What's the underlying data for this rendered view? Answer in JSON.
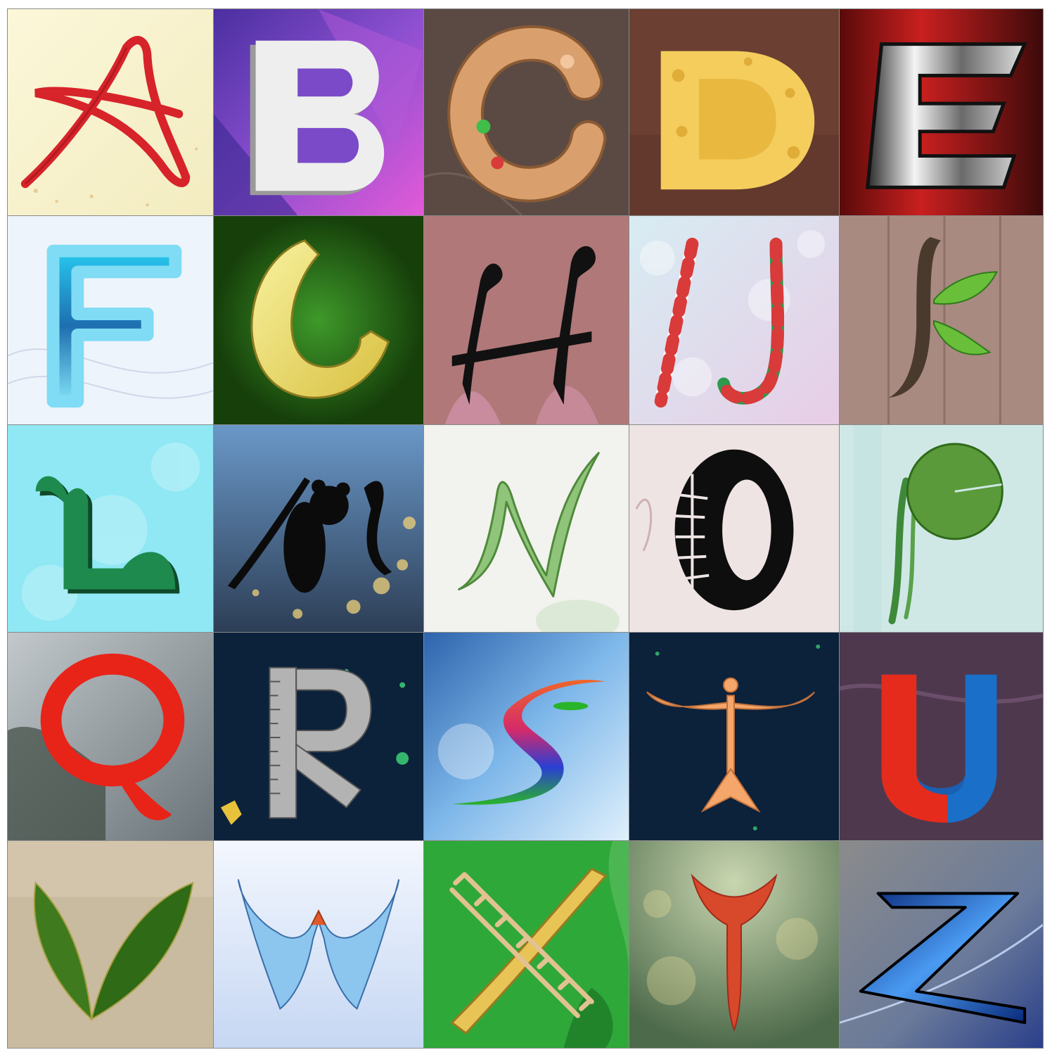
{
  "tiles": [
    {
      "letter": "A",
      "icon": "red-ribbon-a-icon",
      "bg": [
        "#fbf7d9",
        "#f3ecc0"
      ],
      "color": "#d7232a"
    },
    {
      "letter": "B",
      "icon": "white-3d-block-b-icon",
      "bg": [
        "#5b3fb8",
        "#d652d6"
      ],
      "color": "#eeeeee"
    },
    {
      "letter": "C",
      "icon": "gingerbread-cookie-c-icon",
      "bg": [
        "#5e4e47",
        "#4b3d37"
      ],
      "color": "#d9a06e"
    },
    {
      "letter": "D",
      "icon": "cheese-d-icon",
      "bg": [
        "#7a4a3b",
        "#5c3427"
      ],
      "color": "#f5cd5c"
    },
    {
      "letter": "E",
      "icon": "chrome-metal-e-icon",
      "bg": [
        "#b81d1d",
        "#3d0a0a"
      ],
      "color": "#c8c8c8"
    },
    {
      "letter": "F",
      "icon": "blue-cloud-f-icon",
      "bg": [
        "#eef4fb",
        "#e4ecf6"
      ],
      "color": "#2fb8e6"
    },
    {
      "letter": "G",
      "icon": "yellow-banana-g-icon",
      "bg": [
        "#2f7d1a",
        "#1a4d0c"
      ],
      "color": "#f2e56a"
    },
    {
      "letter": "H",
      "icon": "black-music-note-h-icon",
      "bg": [
        "#b07878",
        "#8f5a5a"
      ],
      "color": "#111111"
    },
    {
      "letter": "IJ",
      "icon": "candy-cane-ij-icon",
      "bg": [
        "#d8e8f0",
        "#e8cde6"
      ],
      "color": "#d93a3a"
    },
    {
      "letter": "K",
      "icon": "wood-leaf-k-icon",
      "bg": [
        "#a98a80",
        "#8d7068"
      ],
      "color": "#4a3a2e"
    },
    {
      "letter": "L",
      "icon": "green-dinosaur-l-icon",
      "bg": [
        "#7fe4f2",
        "#a9eef6"
      ],
      "color": "#1e8a4e"
    },
    {
      "letter": "M",
      "icon": "black-mouse-m-icon",
      "bg": [
        "#6a98c8",
        "#33465e"
      ],
      "color": "#0b0b0b"
    },
    {
      "letter": "N",
      "icon": "green-leaf-n-icon",
      "bg": [
        "#f2f2ef",
        "#e8ebe4"
      ],
      "color": "#5c9c48"
    },
    {
      "letter": "O",
      "icon": "tire-o-icon",
      "bg": [
        "#efe4e4",
        "#e6d6d8"
      ],
      "color": "#0e0e0e"
    },
    {
      "letter": "P",
      "icon": "lily-pad-p-icon",
      "bg": [
        "#cfe8e6",
        "#b9dedb"
      ],
      "color": "#4f8a3a"
    },
    {
      "letter": "Q",
      "icon": "red-fuzzy-q-icon",
      "bg": [
        "#9aa4ad",
        "#3e4a42"
      ],
      "color": "#e82419"
    },
    {
      "letter": "R",
      "icon": "ruler-protractor-r-icon",
      "bg": [
        "#0c213a",
        "#0a1b30"
      ],
      "color": "#b3b3b3"
    },
    {
      "letter": "S",
      "icon": "rainbow-wave-s-icon",
      "bg": [
        "#2d64ad",
        "#9fd0f2"
      ],
      "color": "#f0662a"
    },
    {
      "letter": "T",
      "icon": "orange-figure-t-icon",
      "bg": [
        "#0c213a",
        "#0a1b30"
      ],
      "color": "#f5a66a"
    },
    {
      "letter": "U",
      "icon": "magnet-u-icon",
      "bg": [
        "#5a3f5a",
        "#3d2a3a"
      ],
      "color": "#e52b1c"
    },
    {
      "letter": "V",
      "icon": "green-leaves-v-icon",
      "bg": [
        "#cdbfa3",
        "#b6a88c"
      ],
      "color": "#3f7a1e"
    },
    {
      "letter": "W",
      "icon": "blue-birds-w-icon",
      "bg": [
        "#eaf1fd",
        "#c9d9f4"
      ],
      "color": "#8cc5ee"
    },
    {
      "letter": "X",
      "icon": "ladder-slide-x-icon",
      "bg": [
        "#2fa83a",
        "#1e8a28"
      ],
      "color": "#e2c290"
    },
    {
      "letter": "Y",
      "icon": "fish-tail-y-icon",
      "bg": [
        "#7f9a62",
        "#4d6a4a"
      ],
      "color": "#d8482a"
    },
    {
      "letter": "Z",
      "icon": "blue-lightning-z-icon",
      "bg": [
        "#8b8b8b",
        "#2a3f8a"
      ],
      "color": "#1d5fd4"
    }
  ]
}
